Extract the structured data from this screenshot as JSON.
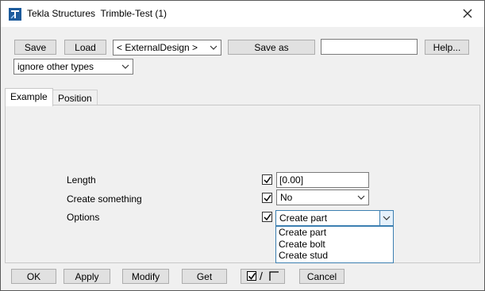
{
  "window": {
    "title": "Tekla Structures  Trimble-Test (1)"
  },
  "toolbar": {
    "save_label": "Save",
    "load_label": "Load",
    "attribute_set": "< ExternalDesign >",
    "save_as_label": "Save as",
    "save_as_value": "",
    "help_label": "Help..."
  },
  "filter": {
    "selected": "ignore other types"
  },
  "tabs": [
    {
      "label": "Example",
      "active": true
    },
    {
      "label": "Position",
      "active": false
    }
  ],
  "fields": {
    "length": {
      "label": "Length",
      "value": "[0.00]",
      "checked": true
    },
    "create_something": {
      "label": "Create something",
      "value": "No",
      "checked": true
    },
    "options": {
      "label": "Options",
      "value": "Create part",
      "checked": true
    }
  },
  "options_dropdown": {
    "items": [
      "Create part",
      "Create bolt",
      "Create stud"
    ]
  },
  "bottom_bar": {
    "ok_label": "OK",
    "apply_label": "Apply",
    "modify_label": "Modify",
    "get_label": "Get",
    "toggle_separator": "/",
    "cancel_label": "Cancel"
  }
}
